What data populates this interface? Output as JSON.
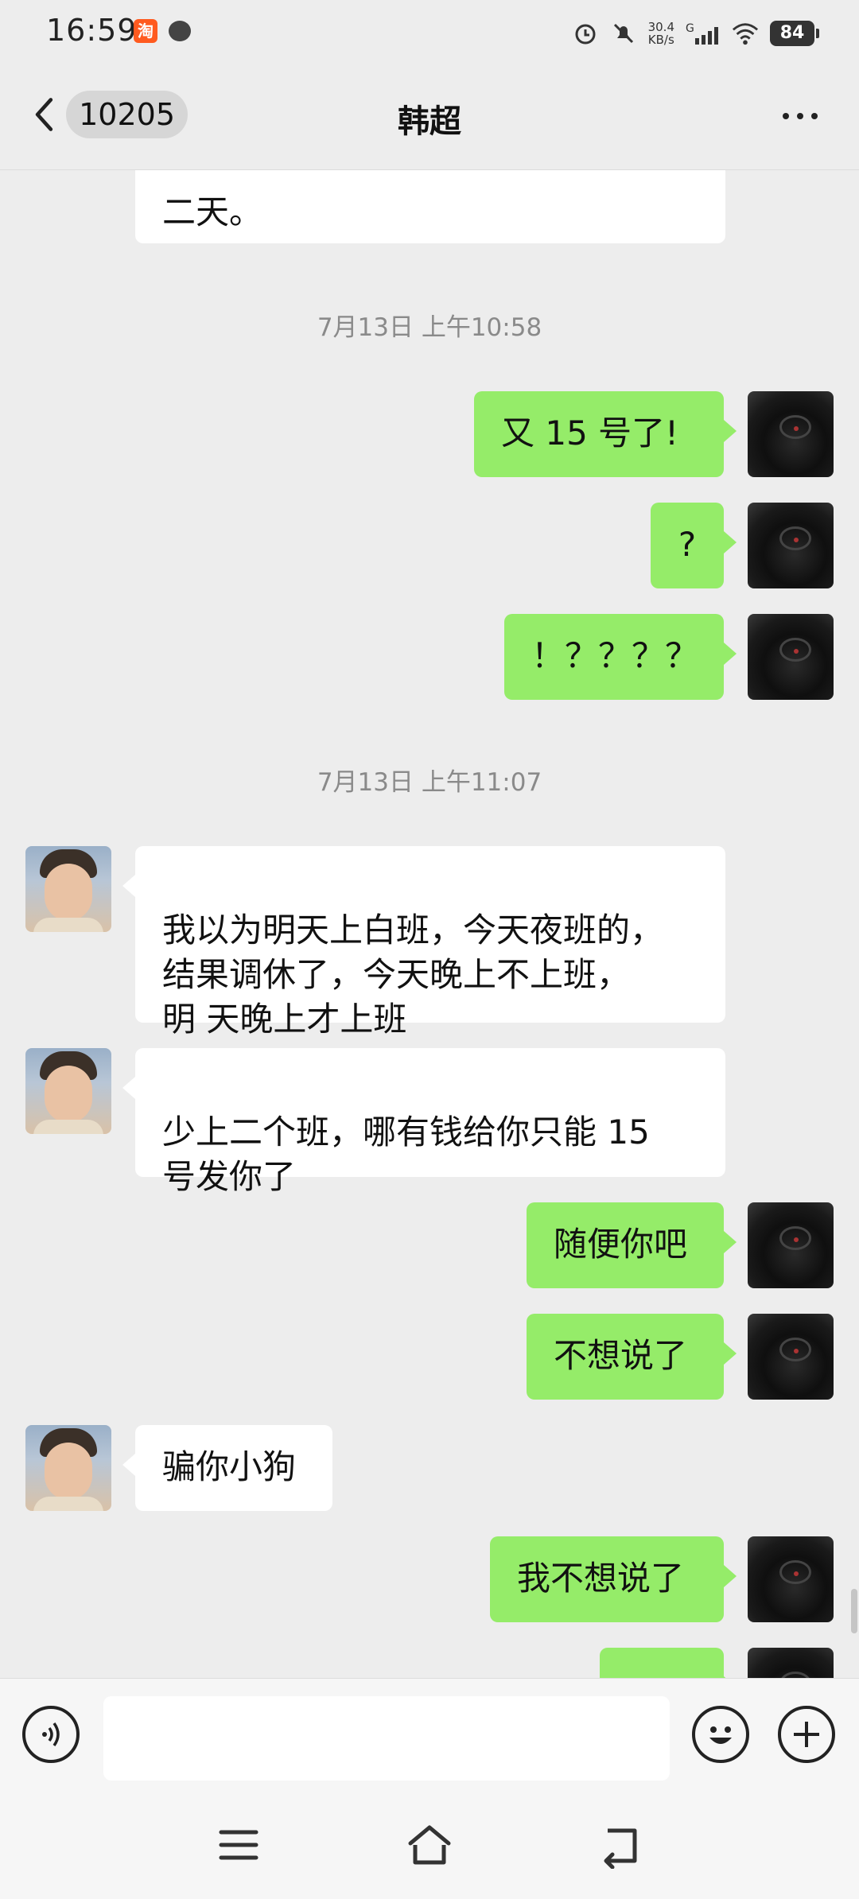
{
  "status_bar": {
    "time": "16:59",
    "app_icon_1": "淘",
    "net_speed": "30.4",
    "net_unit": "KB/s",
    "signal_label": "G",
    "battery": "84"
  },
  "header": {
    "back_count": "10205",
    "title": "韩超"
  },
  "messages": {
    "m0": "二天。",
    "ts1": "7月13日 上午10:58",
    "m1": "又 15 号了!",
    "m2": "?",
    "m3": "！？？？？",
    "ts2": "7月13日 上午11:07",
    "m4": "我以为明天上白班，今天夜班的，\n结果调休了，今天晚上不上班，\n明 天晚上才上班",
    "m5": "少上二个班，哪有钱给你只能 15\n号发你了",
    "m6": "随便你吧",
    "m7": "不想说了",
    "m8": "骗你小狗",
    "m9": "我不想说了"
  },
  "input": {
    "placeholder": ""
  },
  "icons": {
    "back": "chevron-left-icon",
    "more": "more-dots-icon",
    "voice": "voice-icon",
    "emoji": "emoji-icon",
    "add": "plus-icon",
    "menu": "menu-icon",
    "home": "home-icon",
    "return": "back-nav-icon"
  },
  "colors": {
    "outgoing_bubble": "#95ec69",
    "incoming_bubble": "#ffffff",
    "background": "#ededed"
  }
}
